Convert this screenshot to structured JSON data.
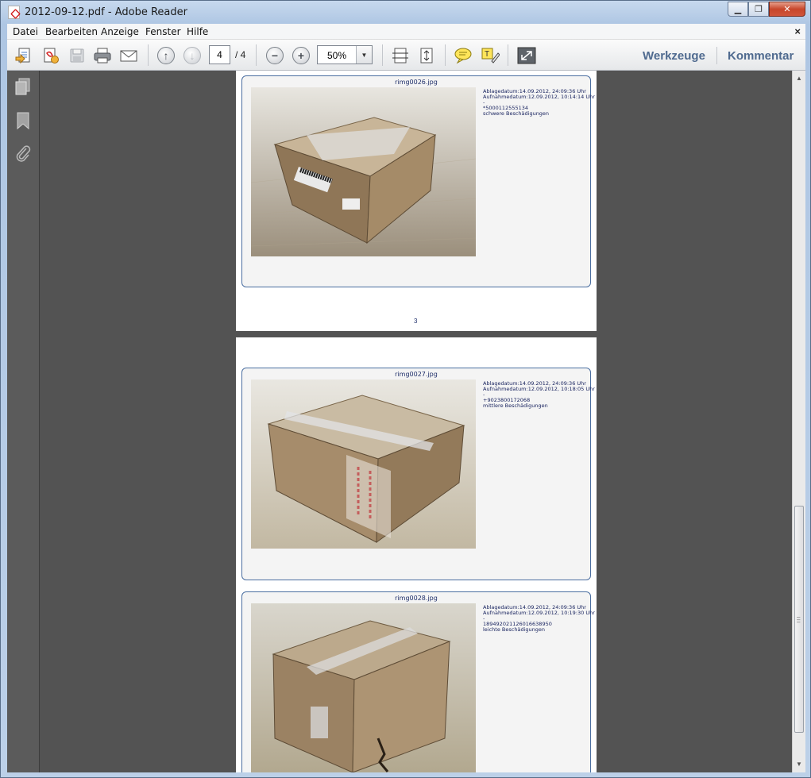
{
  "window": {
    "title": "2012-09-12.pdf - Adobe Reader",
    "buttons": {
      "minimize": "▁",
      "maximize": "❐",
      "close": "✕"
    }
  },
  "menubar": {
    "items": [
      "Datei",
      "Bearbeiten",
      "Anzeige",
      "Fenster",
      "Hilfe"
    ],
    "close": "×"
  },
  "toolbar": {
    "current_page": "4",
    "page_total": "/ 4",
    "zoom": "50%",
    "werkzeuge": "Werkzeuge",
    "kommentar": "Kommentar",
    "icons": [
      "open-file-icon",
      "create-pdf-icon",
      "save-icon",
      "print-icon",
      "email-icon",
      "previous-page-icon",
      "next-page-icon",
      "zoom-out-icon",
      "zoom-in-icon",
      "fit-width-icon",
      "fit-page-icon",
      "comment-icon",
      "highlight-icon",
      "fullscreen-icon"
    ]
  },
  "sidebar": {
    "icons": [
      "pages-icon",
      "bookmarks-icon",
      "attachments-icon"
    ]
  },
  "document": {
    "page3": {
      "page_number": "3",
      "card": {
        "filename": "rimg0026.jpg",
        "ablage": "Ablagedatum:14.09.2012, 24:09:36 Uhr",
        "aufnahme": "Aufnahmedatum:12.09.2012, 10:14:14 Uhr",
        "dash": "-",
        "code": "*5000112555134",
        "damage": "schwere Beschädigungen"
      }
    },
    "page4": {
      "cards": [
        {
          "filename": "rimg0027.jpg",
          "ablage": "Ablagedatum:14.09.2012, 24:09:36 Uhr",
          "aufnahme": "Aufnahmedatum:12.09.2012, 10:18:05 Uhr",
          "dash": "-",
          "code": "+9023800172068",
          "damage": "mittlere Beschädigungen"
        },
        {
          "filename": "rimg0028.jpg",
          "ablage": "Ablagedatum:14.09.2012, 24:09:36 Uhr",
          "aufnahme": "Aufnahmedatum:12.09.2012, 10:19:30 Uhr",
          "dash": "-",
          "code": "1894920211260166389​50",
          "damage": "leichte Beschädigungen"
        }
      ]
    }
  },
  "colors": {
    "accent": "#4f6a8f",
    "doc_background": "#535353",
    "card_border": "#4a6ea0"
  }
}
